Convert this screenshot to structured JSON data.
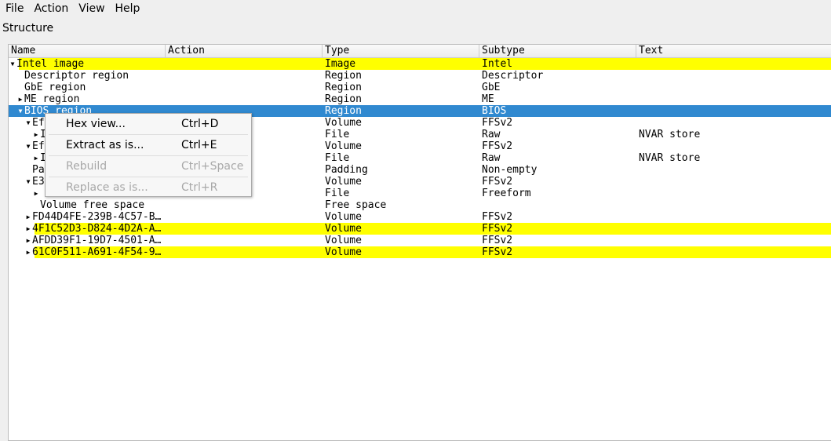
{
  "menubar": [
    {
      "label": "File"
    },
    {
      "label": "Action"
    },
    {
      "label": "View"
    },
    {
      "label": "Help"
    }
  ],
  "panel_title": "Structure",
  "columns": [
    "Name",
    "Action",
    "Type",
    "Subtype",
    "Text"
  ],
  "rows": [
    {
      "indent": 0,
      "arrow": "▼",
      "name": "Intel image",
      "type": "Image",
      "subtype": "Intel",
      "text": "",
      "style": "hl"
    },
    {
      "indent": 1,
      "arrow": "",
      "name": "Descriptor region",
      "type": "Region",
      "subtype": "Descriptor",
      "text": "",
      "style": ""
    },
    {
      "indent": 1,
      "arrow": "",
      "name": "GbE region",
      "type": "Region",
      "subtype": "GbE",
      "text": "",
      "style": ""
    },
    {
      "indent": 1,
      "arrow": "▶",
      "name": "ME region",
      "type": "Region",
      "subtype": "ME",
      "text": "",
      "style": ""
    },
    {
      "indent": 1,
      "arrow": "▼",
      "name": "BIOS region",
      "type": "Region",
      "subtype": "BIOS",
      "text": "",
      "style": "sel"
    },
    {
      "indent": 2,
      "arrow": "▼",
      "name": "Ef",
      "type": "Volume",
      "subtype": "FFSv2",
      "text": "",
      "style": ""
    },
    {
      "indent": 3,
      "arrow": "▶",
      "name": "I",
      "type": "File",
      "subtype": "Raw",
      "text": "NVAR store",
      "style": ""
    },
    {
      "indent": 2,
      "arrow": "▼",
      "name": "Ef",
      "type": "Volume",
      "subtype": "FFSv2",
      "text": "",
      "style": ""
    },
    {
      "indent": 3,
      "arrow": "▶",
      "name": "I",
      "type": "File",
      "subtype": "Raw",
      "text": "NVAR store",
      "style": ""
    },
    {
      "indent": 2,
      "arrow": "",
      "name": "Pa",
      "type": "Padding",
      "subtype": "Non-empty",
      "text": "",
      "style": ""
    },
    {
      "indent": 2,
      "arrow": "▼",
      "name": "E3",
      "type": "Volume",
      "subtype": "FFSv2",
      "text": "",
      "style": ""
    },
    {
      "indent": 3,
      "arrow": "▶",
      "name": "",
      "type": "File",
      "subtype": "Freeform",
      "text": "",
      "style": ""
    },
    {
      "indent": 3,
      "arrow": "",
      "name": "Volume free space",
      "type": "Free space",
      "subtype": "",
      "text": "",
      "style": ""
    },
    {
      "indent": 2,
      "arrow": "▶",
      "name": "FD44D4FE-239B-4C57-B…",
      "type": "Volume",
      "subtype": "FFSv2",
      "text": "",
      "style": ""
    },
    {
      "indent": 2,
      "arrow": "▶",
      "name": "4F1C52D3-D824-4D2A-A…",
      "type": "Volume",
      "subtype": "FFSv2",
      "text": "",
      "style": "hl"
    },
    {
      "indent": 2,
      "arrow": "▶",
      "name": "AFDD39F1-19D7-4501-A…",
      "type": "Volume",
      "subtype": "FFSv2",
      "text": "",
      "style": ""
    },
    {
      "indent": 2,
      "arrow": "▶",
      "name": "61C0F511-A691-4F54-9…",
      "type": "Volume",
      "subtype": "FFSv2",
      "text": "",
      "style": "hl"
    }
  ],
  "context_menu": [
    {
      "label": "Hex view...",
      "shortcut": "Ctrl+D",
      "enabled": true
    },
    {
      "label": "Extract as is...",
      "shortcut": "Ctrl+E",
      "enabled": true
    },
    {
      "label": "Rebuild",
      "shortcut": "Ctrl+Space",
      "enabled": false
    },
    {
      "label": "Replace as is...",
      "shortcut": "Ctrl+R",
      "enabled": false
    }
  ],
  "colors": {
    "highlight": "#ffff00",
    "selection": "#3089d0"
  }
}
